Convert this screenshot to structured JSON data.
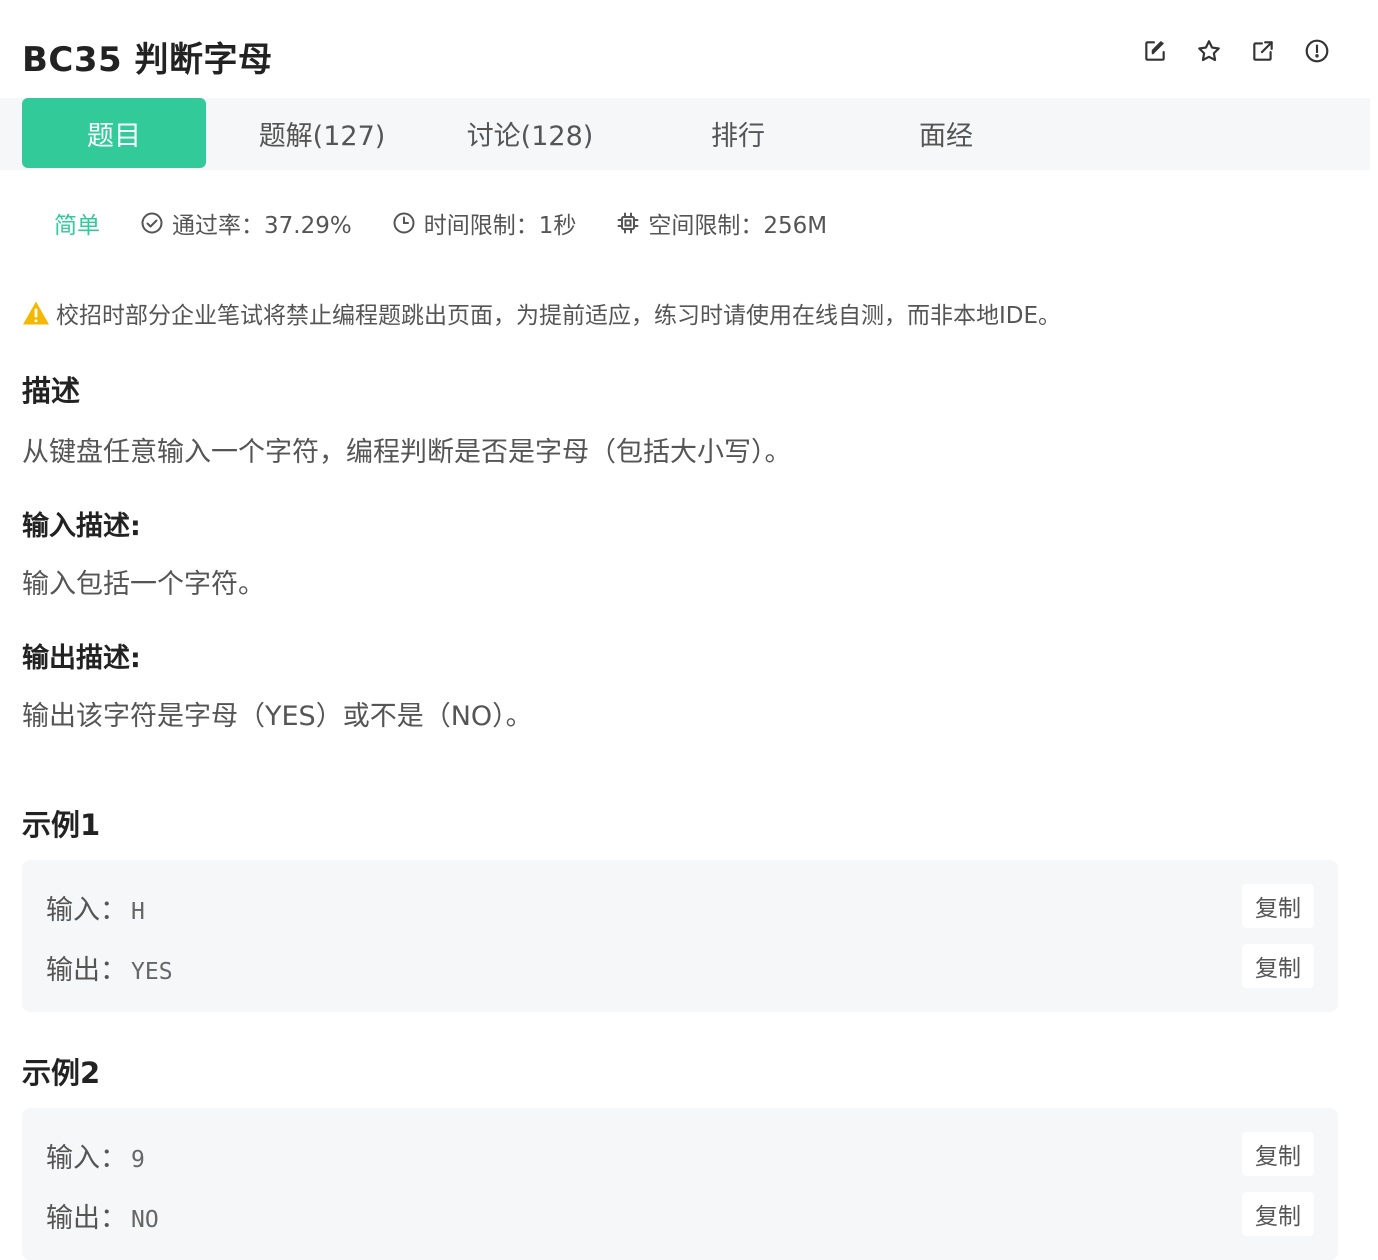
{
  "header": {
    "title": "BC35  判断字母",
    "icons": [
      "edit-icon",
      "star-icon",
      "share-icon",
      "report-icon"
    ]
  },
  "tabs": [
    {
      "label": "题目",
      "active": true
    },
    {
      "label": "题解(127)",
      "active": false
    },
    {
      "label": "讨论(128)",
      "active": false
    },
    {
      "label": "排行",
      "active": false
    },
    {
      "label": "面经",
      "active": false
    }
  ],
  "meta": {
    "difficulty": "简单",
    "pass_rate": "通过率：37.29%",
    "time_limit": "时间限制：1秒",
    "space_limit": "空间限制：256M"
  },
  "notice": "校招时部分企业笔试将禁止编程题跳出页面，为提前适应，练习时请使用在线自测，而非本地IDE。",
  "description": {
    "heading": "描述",
    "text": "从键盘任意输入一个字符，编程判断是否是字母（包括大小写）。"
  },
  "input_desc": {
    "heading": "输入描述:",
    "text": "输入包括一个字符。"
  },
  "output_desc": {
    "heading": "输出描述:",
    "text": "输出该字符是字母（YES）或不是（NO）。"
  },
  "examples": [
    {
      "heading": "示例1",
      "input_label": "输入：",
      "input_value": "H",
      "output_label": "输出：",
      "output_value": "YES",
      "copy_label": "复制"
    },
    {
      "heading": "示例2",
      "input_label": "输入：",
      "input_value": "9",
      "output_label": "输出：",
      "output_value": "NO",
      "copy_label": "复制"
    }
  ],
  "colors": {
    "accent": "#32ca99",
    "panel_bg": "#f6f7f8",
    "warning": "#f5b800"
  }
}
